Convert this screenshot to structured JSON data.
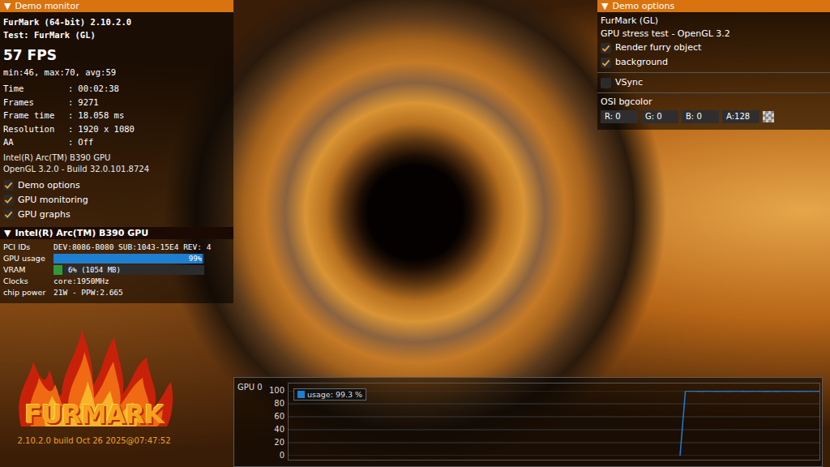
{
  "monitor": {
    "toggle": "▼",
    "title": "Demo monitor",
    "app": "FurMark (64-bit) 2.10.2.0",
    "test": "Test: FurMark (GL)",
    "fps": "57 FPS",
    "fps_range": "min:46, max:70, avg:59",
    "separator": ":",
    "stats": [
      {
        "label": "Time",
        "value": "00:02:38"
      },
      {
        "label": "Frames",
        "value": "9271"
      },
      {
        "label": "Frame time",
        "value": "18.058 ms"
      },
      {
        "label": "Resolution",
        "value": "1920 x 1080"
      },
      {
        "label": "AA",
        "value": "Off"
      }
    ],
    "gpu_name": "Intel(R) Arc(TM) B390 GPU",
    "renderer": "OpenGL 3.2.0 - Build 32.0.101.8724",
    "toggles": [
      {
        "label": "Demo options",
        "checked": true
      },
      {
        "label": "GPU monitoring",
        "checked": true
      },
      {
        "label": "GPU graphs",
        "checked": true
      }
    ]
  },
  "gpu": {
    "toggle": "▼",
    "title": "Intel(R) Arc(TM) B390 GPU",
    "rows": [
      {
        "kind": "text",
        "label": "PCI IDs",
        "value": "DEV:8086-B080 SUB:1043-15E4 REV: 4"
      },
      {
        "kind": "bar",
        "label": "GPU usage",
        "value": "99%",
        "level": 0.99,
        "color": "#1e7fd0"
      },
      {
        "kind": "bar",
        "label": "VRAM",
        "value": "6% (1054 MB)",
        "level": 0.06,
        "color": "#2f9a3c"
      },
      {
        "kind": "text",
        "label": "Clocks",
        "value": "core:1950MHz"
      },
      {
        "kind": "text",
        "label": "chip power",
        "value": "21W - PPW:2.665"
      }
    ]
  },
  "logo": {
    "name": "FURMARK",
    "build": "2.10.2.0 build Oct 26 2025@07:47:52"
  },
  "options": {
    "toggle": "▼",
    "title": "Demo options",
    "demo": "FurMark (GL)",
    "description": "GPU stress test - OpenGL 3.2",
    "check_groups": [
      {
        "items": [
          {
            "label": "Render furry object",
            "checked": true
          },
          {
            "label": "background",
            "checked": true
          }
        ]
      },
      {
        "items": [
          {
            "label": "VSync",
            "checked": false
          }
        ]
      }
    ],
    "bgcolor": {
      "label": "OSI bgcolor",
      "fields": [
        "R: 0",
        "G: 0",
        "B: 0",
        "A:128"
      ]
    }
  },
  "graph": {
    "title": "GPU 0",
    "ticks": [
      "100",
      "80",
      "60",
      "40",
      "20",
      "0"
    ],
    "legend": "usage: 99.3 %",
    "series": [
      {
        "name": "usage",
        "color": "#1e7fd0",
        "values": [
          0,
          99.6,
          99.4,
          99.3,
          99.2,
          99.4,
          99.3,
          99.1,
          99.3,
          99.2,
          99.4,
          99.3,
          99.2,
          99.3,
          99.3,
          99.4,
          99.2,
          99.3,
          99.1,
          99.3,
          99.4,
          99.3,
          99.2,
          99.3,
          99.3,
          99.3,
          99.3
        ]
      }
    ]
  }
}
